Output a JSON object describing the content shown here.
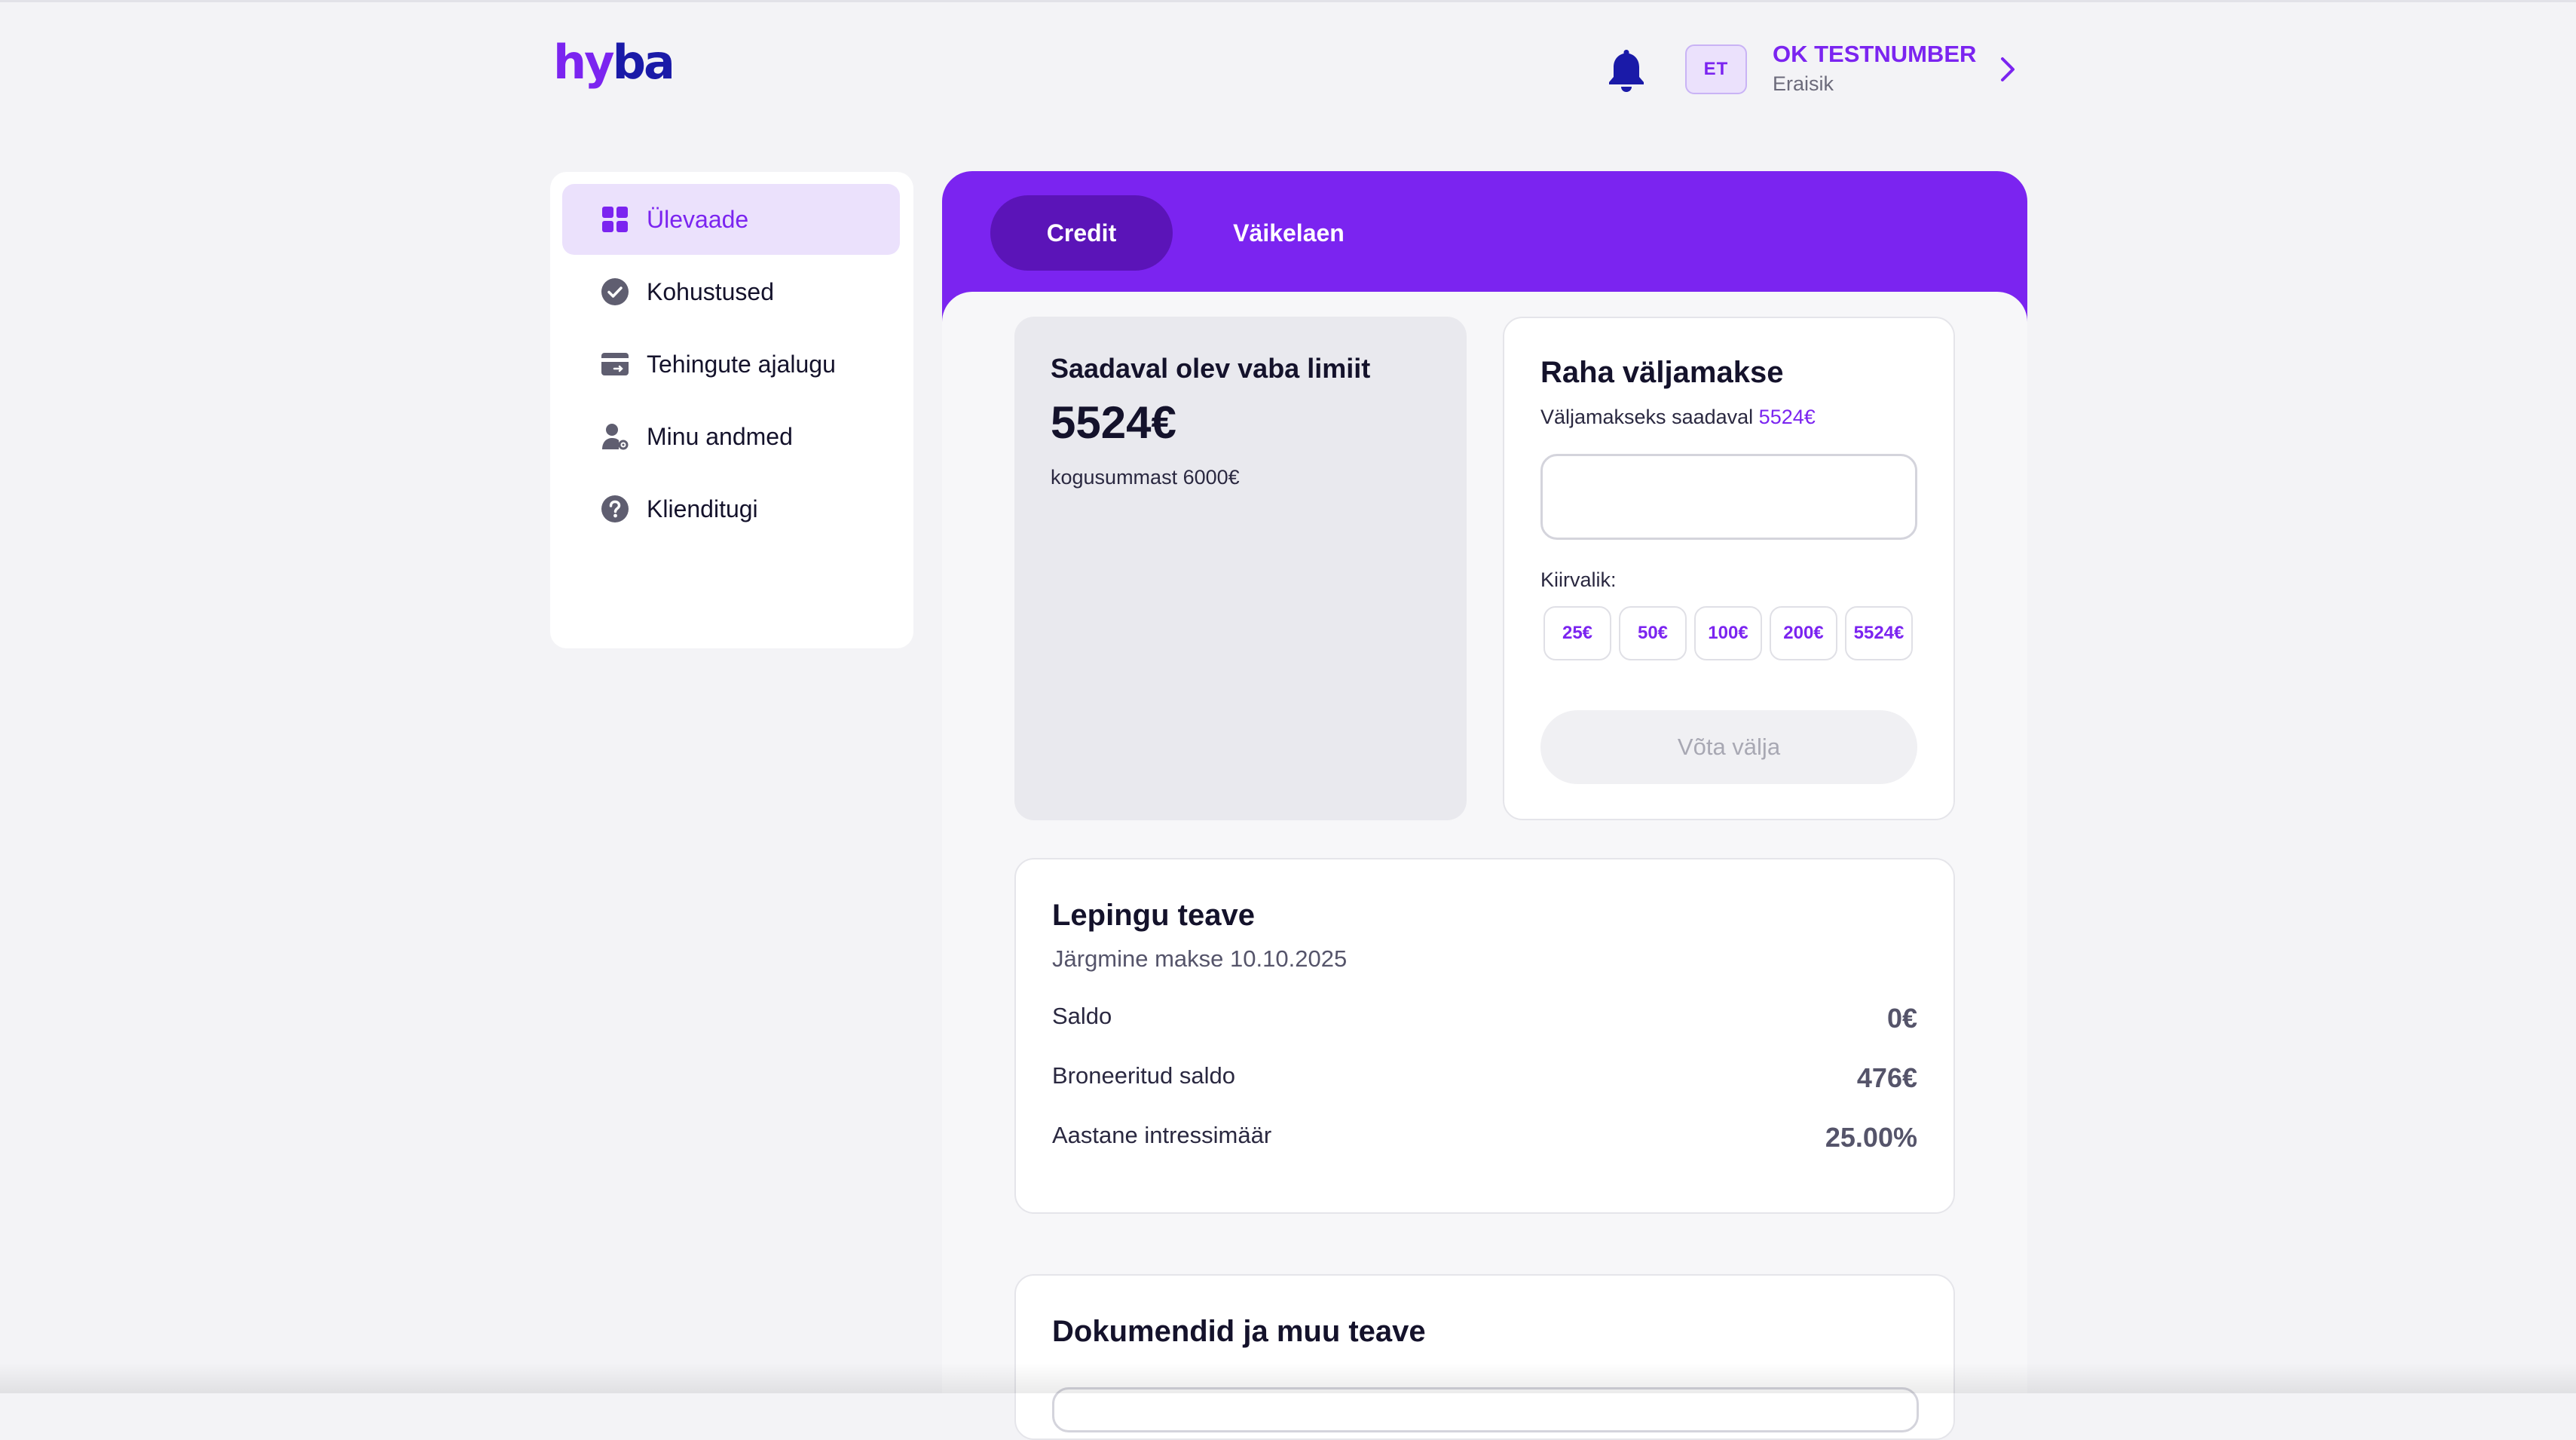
{
  "header": {
    "logo_text": "hyba",
    "language": "ET",
    "user_name": "OK TESTNUMBER",
    "user_type": "Eraisik"
  },
  "sidebar": {
    "items": [
      {
        "label": "Ülevaade",
        "icon": "dashboard-grid-icon",
        "active": true
      },
      {
        "label": "Kohustused",
        "icon": "check-circle-icon",
        "active": false
      },
      {
        "label": "Tehingute ajalugu",
        "icon": "card-icon",
        "active": false
      },
      {
        "label": "Minu andmed",
        "icon": "user-gear-icon",
        "active": false
      },
      {
        "label": "Klienditugi",
        "icon": "help-circle-icon",
        "active": false
      }
    ]
  },
  "tabs": [
    {
      "label": "Credit",
      "active": true
    },
    {
      "label": "Väikelaen",
      "active": false
    }
  ],
  "limit": {
    "title": "Saadaval olev vaba limiit",
    "amount": "5524€",
    "subtitle": "kogusummast 6000€"
  },
  "payout": {
    "title": "Raha väljamakse",
    "available_label": "Väljamakseks saadaval",
    "available_amount": "5524€",
    "amount_value": "",
    "quick_label": "Kiirvalik:",
    "quick_options": [
      "25€",
      "50€",
      "100€",
      "200€",
      "5524€"
    ],
    "submit_label": "Võta välja"
  },
  "contract": {
    "title": "Lepingu teave",
    "next_payment": "Järgmine makse 10.10.2025",
    "rows": [
      {
        "label": "Saldo",
        "value": "0€"
      },
      {
        "label": "Broneeritud saldo",
        "value": "476€"
      },
      {
        "label": "Aastane intressimäär",
        "value": "25.00%"
      }
    ]
  },
  "documents": {
    "title": "Dokumendid ja muu teave"
  },
  "colors": {
    "brand_purple": "#7b24f0",
    "brand_navy": "#1a1aa8",
    "active_tab": "#5b14b8",
    "background": "#f3f3f6"
  }
}
